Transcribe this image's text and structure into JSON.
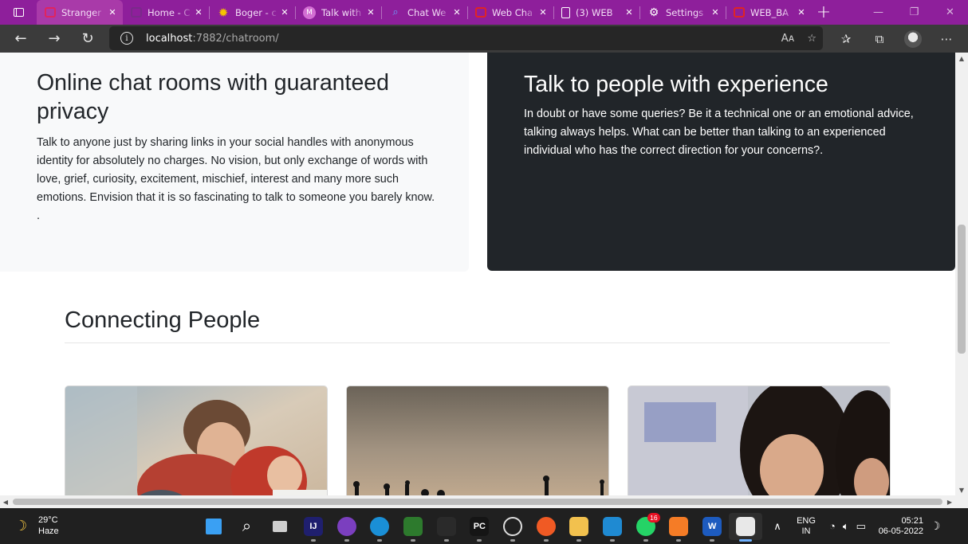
{
  "browser": {
    "tabs": [
      {
        "title": "Stranger",
        "icon": "chat-app-icon",
        "active": true
      },
      {
        "title": "Home - C",
        "icon": "home-page-icon",
        "active": false
      },
      {
        "title": "Boger - c",
        "icon": "star-sun-icon",
        "active": false
      },
      {
        "title": "Talk with",
        "icon": "m-logo-icon",
        "active": false
      },
      {
        "title": "Chat We",
        "icon": "search-logo-icon",
        "active": false
      },
      {
        "title": "Web Cha",
        "icon": "web-chat-icon",
        "active": false
      },
      {
        "title": "(3) WEB",
        "icon": "document-icon",
        "active": false
      },
      {
        "title": "Settings",
        "icon": "gear-icon",
        "active": false
      },
      {
        "title": "WEB_BA",
        "icon": "pdf-icon",
        "active": false
      }
    ],
    "url_host": "localhost",
    "url_rest": ":7882/chatroom/"
  },
  "page": {
    "privacy": {
      "title": "Online chat rooms with guaranteed privacy",
      "body": "Talk to anyone just by sharing links in your social handles with anonymous identity for absolutely no charges. No vision, but only exchange of words with love, grief, curiosity, excitement, mischief, interest and many more such emotions. Envision that it is so fascinating to talk to someone you barely know. ."
    },
    "experience": {
      "title": "Talk to people with experience",
      "body": "In doubt or have some queries? Be it a technical one or an emotional advice, talking always helps. What can be better than talking to an experienced individual who has the correct direction for your concerns?."
    },
    "connecting": {
      "title": "Connecting People"
    }
  },
  "taskbar": {
    "temperature": "29°C",
    "condition": "Haze",
    "apps": [
      {
        "name": "windows-start-icon",
        "label": "",
        "color": "#3aa0f3"
      },
      {
        "name": "search-icon",
        "label": "",
        "color": "#202020"
      },
      {
        "name": "task-view-icon",
        "label": "",
        "color": "#202020"
      },
      {
        "name": "intellij-icon",
        "label": "IJ",
        "color": "#1f1f6e"
      },
      {
        "name": "github-icon",
        "label": "",
        "color": "#7b3fbf"
      },
      {
        "name": "edge-icon",
        "label": "",
        "color": "#1a8fd6"
      },
      {
        "name": "git-icon",
        "label": "",
        "color": "#2d7a2d"
      },
      {
        "name": "files-icon",
        "label": "",
        "color": "#2a2a2a"
      },
      {
        "name": "pycharm-icon",
        "label": "PC",
        "color": "#151515"
      },
      {
        "name": "obs-icon",
        "label": "",
        "color": "#202020"
      },
      {
        "name": "brave-icon",
        "label": "",
        "color": "#f05a24"
      },
      {
        "name": "file-explorer-icon",
        "label": "",
        "color": "#f2c14e"
      },
      {
        "name": "vscode-icon",
        "label": "",
        "color": "#1f8ad2"
      },
      {
        "name": "whatsapp-icon",
        "label": "",
        "color": "#25d366",
        "badge": "16"
      },
      {
        "name": "xampp-icon",
        "label": "",
        "color": "#f57c26"
      },
      {
        "name": "word-icon",
        "label": "W",
        "color": "#1d5bbf"
      },
      {
        "name": "snipping-tool-icon",
        "label": "",
        "color": "#e8e8e8"
      }
    ],
    "language": "ENG",
    "region": "IN",
    "time": "05:21",
    "date": "06-05-2022"
  }
}
